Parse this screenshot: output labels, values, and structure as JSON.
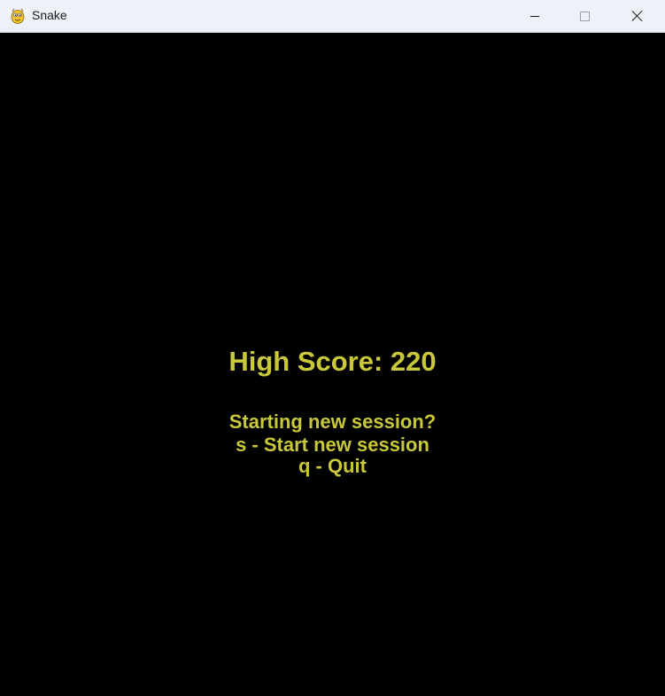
{
  "window": {
    "title": "Snake",
    "app_icon": "pygame-snake-icon",
    "controls": {
      "minimize_icon": "minimize-icon",
      "maximize_icon": "maximize-icon",
      "close_icon": "close-icon"
    }
  },
  "game": {
    "background_color": "#000000",
    "text_color": "#c8c83a",
    "high_score_label": "High Score: 220",
    "prompt": "Starting new session?",
    "option_start": "s - Start new session",
    "option_quit": "q - Quit"
  }
}
